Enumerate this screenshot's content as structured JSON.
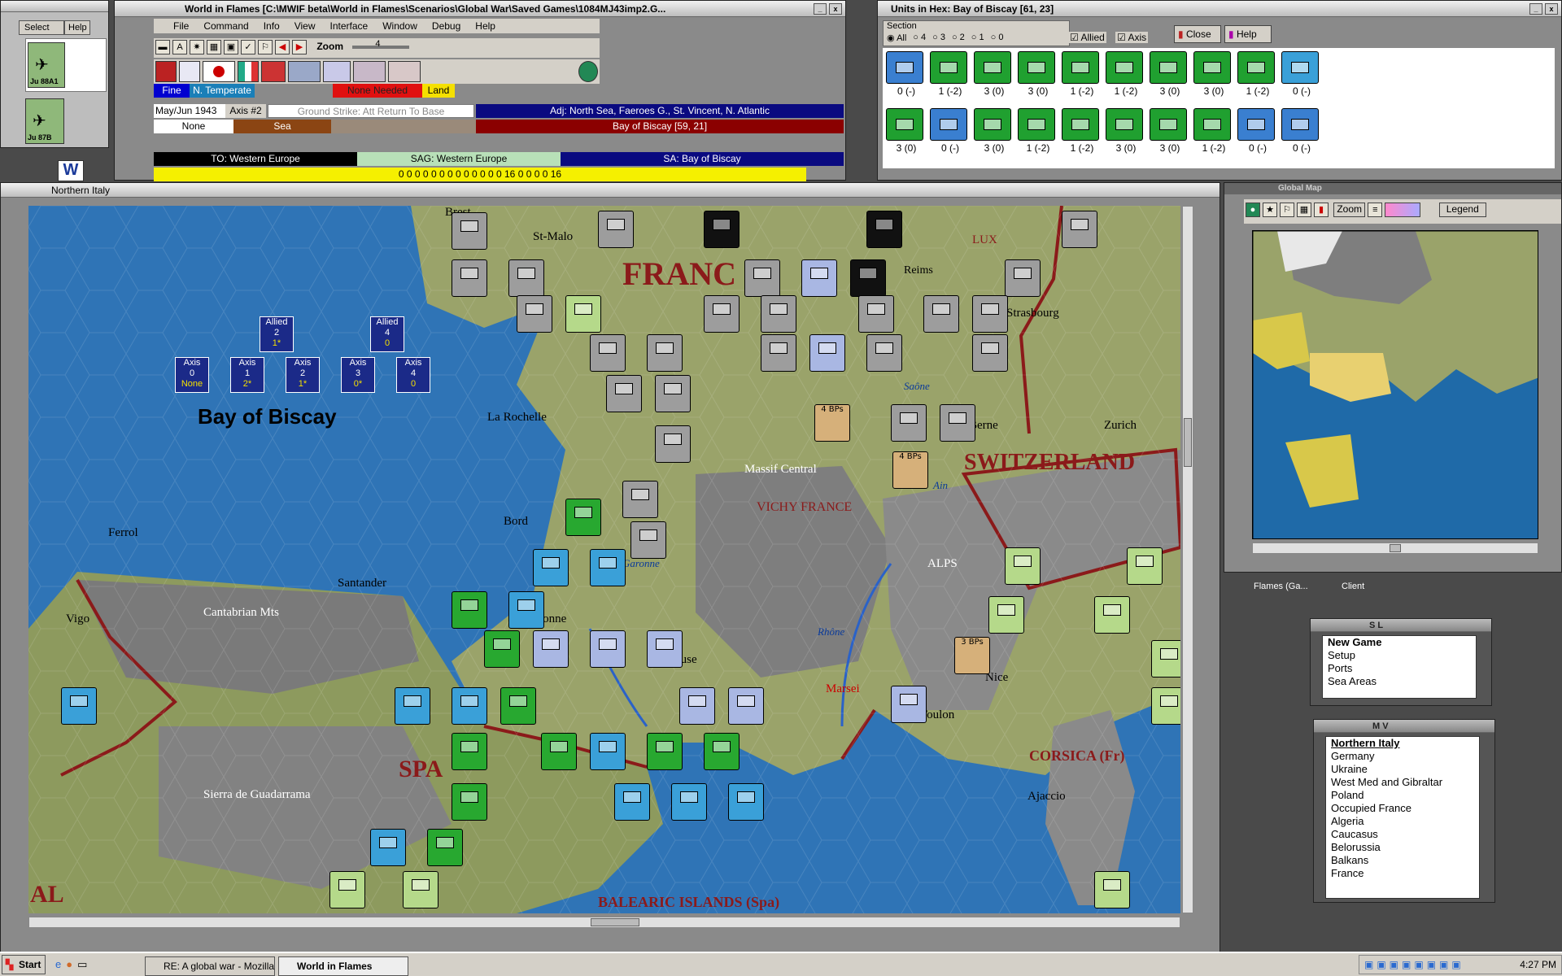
{
  "left_panel": {
    "select_label": "Select",
    "help_label": "Help",
    "unit1_name": "Ju 88A1",
    "unit2_name": "Ju 87B"
  },
  "main_window": {
    "title": "World in Flames [C:\\MWIF beta\\World in Flames\\Scenarios\\Global War\\Saved Games\\1084MJ43imp2.G...",
    "menu": [
      "File",
      "Command",
      "Info",
      "View",
      "Interface",
      "Window",
      "Debug",
      "Help"
    ],
    "zoom_label": "Zoom",
    "zoom_value": "4",
    "weather": "Fine",
    "climate": "N. Temperate",
    "needed": "None Needed",
    "terrain_type": "Land",
    "turn": "May/Jun 1943",
    "impulse": "Axis #2",
    "phase_hint": "Ground Strike: Att Return To Base",
    "adjacent": "Adj: North Sea, Faeroes G., St. Vincent, N. Atlantic",
    "hex_location": "Bay of Biscay [59, 21]",
    "feature": "None",
    "hex_terrain": "Sea",
    "theatre": "TO: Western Europe",
    "sag": "SAG: Western Europe",
    "sea_area": "SA: Bay of Biscay",
    "progress_text": "0 0 0 0 0 0 0 0 0 0 0 0 0 16 0 0 0 0 16"
  },
  "units_window": {
    "title": "Units in Hex: Bay of Biscay [61, 23]",
    "section_label": "Section",
    "filters": [
      "All",
      "4",
      "3",
      "2",
      "1",
      "0"
    ],
    "allied_label": "Allied",
    "axis_label": "Axis",
    "close_label": "Close",
    "help_label": "Help",
    "row1_values": [
      "0 (-)",
      "1 (-2)",
      "3 (0)",
      "3 (0)",
      "1 (-2)",
      "1 (-2)",
      "3 (0)",
      "3 (0)",
      "1 (-2)",
      "0 (-)"
    ],
    "row2_values": [
      "3 (0)",
      "0 (-)",
      "3 (0)",
      "1 (-2)",
      "1 (-2)",
      "3 (0)",
      "3 (0)",
      "1 (-2)",
      "0 (-)",
      "0 (-)"
    ]
  },
  "map_window": {
    "title": "Northern Italy",
    "sea_area_name": "Bay of Biscay",
    "allied_boxes": [
      {
        "label": "Allied",
        "value": "2",
        "sub": "1*"
      },
      {
        "label": "Allied",
        "value": "4",
        "sub": "0"
      }
    ],
    "axis_boxes": [
      {
        "label": "Axis",
        "value": "0",
        "sub": "None"
      },
      {
        "label": "Axis",
        "value": "1",
        "sub": "2*"
      },
      {
        "label": "Axis",
        "value": "2",
        "sub": "1*"
      },
      {
        "label": "Axis",
        "value": "3",
        "sub": "0*"
      },
      {
        "label": "Axis",
        "value": "4",
        "sub": "0"
      }
    ],
    "labels": {
      "france": "FRANC",
      "switzerland": "SWITZERLAND",
      "spain": "SPA",
      "portugal": "AL",
      "corsica": "CORSICA (Fr)",
      "balearic": "BALEARIC ISLANDS (Spa)",
      "vichy": "VICHY FRANCE",
      "massif": "Massif Central",
      "alps": "ALPS",
      "cantabrian": "Cantabrian Mts",
      "guadarrama": "Sierra de Guadarrama",
      "brest": "Brest",
      "stmalo": "St-Malo",
      "reims": "Reims",
      "strasbourg": "Strasbourg",
      "larochelle": "La Rochelle",
      "bordeaux": "Bord",
      "ferrol": "Ferrol",
      "vigo": "Vigo",
      "santander": "Santander",
      "bayonne": "Bayonne",
      "toulouse": "louse",
      "marseille": "Marsei",
      "toulon": "Toulon",
      "nice": "Nice",
      "ajaccio": "Ajaccio",
      "berne": "Berne",
      "zurich": "Zurich",
      "garonne": "Garonne",
      "rhone": "Rhône",
      "saone": "Saône",
      "ain": "Ain",
      "lux": "LUX",
      "bps1": "4 BPs",
      "bps2": "4 BPs",
      "bps3": "3 BPs"
    }
  },
  "global_map": {
    "title": "Global Map",
    "zoom_label": "Zoom",
    "legend_label": "Legend",
    "left_caption": "Flames (Ga...",
    "right_caption": "Client"
  },
  "sl_panel": {
    "title": "S L",
    "items": [
      "New Game",
      "Setup",
      "Ports",
      "Sea Areas"
    ]
  },
  "mv_panel": {
    "title": "M V",
    "items": [
      "Northern Italy",
      "Germany",
      "Ukraine",
      "West Med and Gibraltar",
      "Poland",
      "Occupied France",
      "Algeria",
      "Caucasus",
      "Belorussia",
      "Balkans",
      "France"
    ]
  },
  "taskbar": {
    "start": "Start",
    "task1": "RE: A global war - Mozilla ...",
    "task2": "World in Flames",
    "clock": "4:27 PM"
  },
  "colors": {
    "sea": "#2f74b6",
    "land": "#9aa36a",
    "mountain": "#7e7e7e",
    "border": "#8b1a1a",
    "navy": "#0a0a80"
  }
}
